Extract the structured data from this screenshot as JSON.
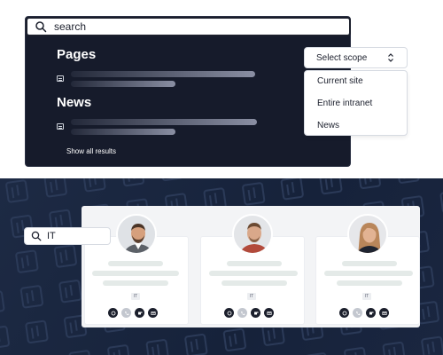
{
  "search": {
    "query": "search",
    "icon": "search-icon"
  },
  "results": {
    "sections": [
      {
        "title": "Pages"
      },
      {
        "title": "News"
      }
    ],
    "show_all_label": "Show all results"
  },
  "scope": {
    "selected_label": "Select scope",
    "options": [
      "Current site",
      "Entire intranet",
      "News"
    ]
  },
  "people": {
    "filter_value": "IT",
    "cards": [
      {
        "department": "IT",
        "avatar": "avatar-man-beard"
      },
      {
        "department": "IT",
        "avatar": "avatar-man-smiling"
      },
      {
        "department": "IT",
        "avatar": "avatar-woman-smiling"
      }
    ]
  },
  "colors": {
    "dark_panel": "#161b2b",
    "page_dark": "#1d2a44",
    "accent_dark": "#1b1f2c"
  }
}
